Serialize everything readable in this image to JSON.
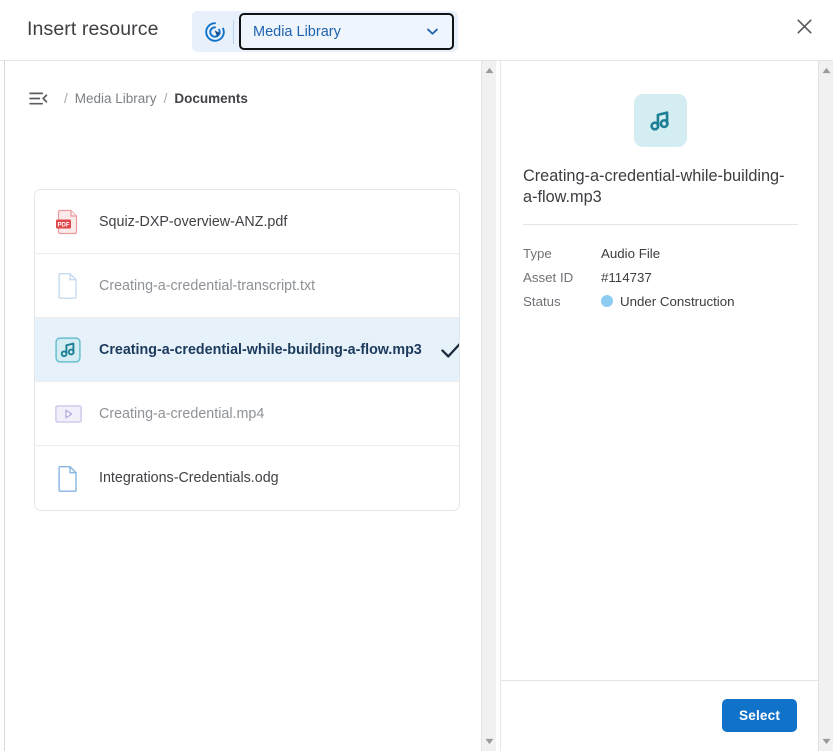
{
  "modal": {
    "title": "Insert resource",
    "close_label": "Close"
  },
  "source_picker": {
    "icon": "target-cursor-icon",
    "selected": "Media Library",
    "chevron": "chevron-down-icon"
  },
  "breadcrumb": {
    "toggle_icon": "collapse-panel-icon",
    "separator": "/",
    "items": [
      {
        "label": "Media Library",
        "current": false
      },
      {
        "label": "Documents",
        "current": true
      }
    ]
  },
  "file_list": [
    {
      "name": "Squiz-DXP-overview-ANZ.pdf",
      "icon": "pdf-file-icon",
      "state": "normal",
      "selected": false
    },
    {
      "name": "Creating-a-credential-transcript.txt",
      "icon": "text-file-icon",
      "state": "dim",
      "selected": false
    },
    {
      "name": "Creating-a-credential-while-building-a-flow.mp3",
      "icon": "audio-file-icon",
      "state": "normal",
      "selected": true,
      "check_icon": "check-icon"
    },
    {
      "name": "Creating-a-credential.mp4",
      "icon": "video-file-icon",
      "state": "dim",
      "selected": false
    },
    {
      "name": "Integrations-Credentials.odg",
      "icon": "document-file-icon",
      "state": "normal",
      "selected": false
    }
  ],
  "detail": {
    "thumbnail_icon": "audio-file-icon",
    "title": "Creating-a-credential-while-building-a-flow.mp3",
    "meta": [
      {
        "key": "Type",
        "value": "Audio File",
        "dot": false
      },
      {
        "key": "Asset ID",
        "value": "#114737",
        "dot": false
      },
      {
        "key": "Status",
        "value": "Under Construction",
        "dot": true
      }
    ],
    "status_dot_color": "#8ecbf0"
  },
  "footer": {
    "select_label": "Select"
  },
  "colors": {
    "accent_blue": "#1072c8",
    "link_blue": "#1f63ae",
    "selected_row_bg": "#e7f1fa",
    "audio_teal": "#1d7f93",
    "pdf_red": "#e0474c",
    "video_purple": "#b9afe0"
  },
  "scrollbars": {
    "left": {
      "up": "scroll-up-arrow",
      "down": "scroll-down-arrow"
    },
    "right": {
      "up": "scroll-up-arrow",
      "down": "scroll-down-arrow"
    }
  }
}
